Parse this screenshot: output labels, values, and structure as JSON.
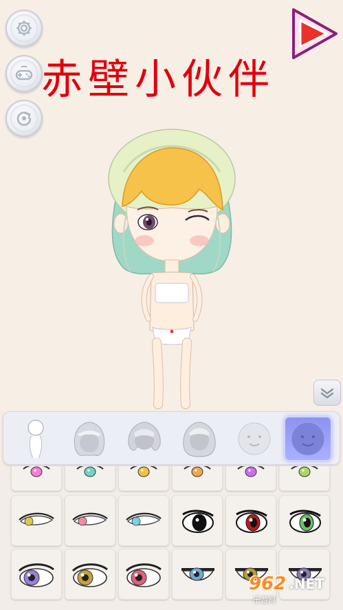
{
  "title": "赤壁小伙伴",
  "left_buttons": {
    "settings": "gear-icon",
    "game": "gamepad-icon",
    "reset": "reset-icon"
  },
  "play_button": "play-icon",
  "collapse_button": "chevron-down-icon",
  "categories": [
    {
      "id": "body",
      "icon": "body-icon",
      "active": false
    },
    {
      "id": "hair-front",
      "icon": "hair-icon",
      "active": false
    },
    {
      "id": "hair-back",
      "icon": "hair-icon",
      "active": false
    },
    {
      "id": "hair-full",
      "icon": "hair-icon",
      "active": false
    },
    {
      "id": "face",
      "icon": "face-icon",
      "active": false
    },
    {
      "id": "eyes",
      "icon": "face-icon",
      "active": true
    }
  ],
  "colors": {
    "accent": "#e0000c",
    "active_tab": "#8d92f0",
    "background": "#f7eee6",
    "play": "#e8322a"
  },
  "eye_options_row1": [
    "#ff7ad6",
    "#6fd4c8",
    "#f2c23d",
    "#f0a64a",
    "#c86ef0",
    "#a6d86a"
  ],
  "eye_options_row2": [
    "#d8c94a",
    "#f08ca0",
    "#7fd0e0",
    "#111111",
    "#c01818",
    "#6bbf68"
  ],
  "eye_options_row3": [
    "#9a7ee0",
    "#c8a03a",
    "#e0607a",
    "#6fa8d8",
    "#b59a3e",
    "#8c7ab8"
  ],
  "watermark": {
    "number": "962",
    "suffix": ".NET",
    "subtitle": "乐游网"
  }
}
